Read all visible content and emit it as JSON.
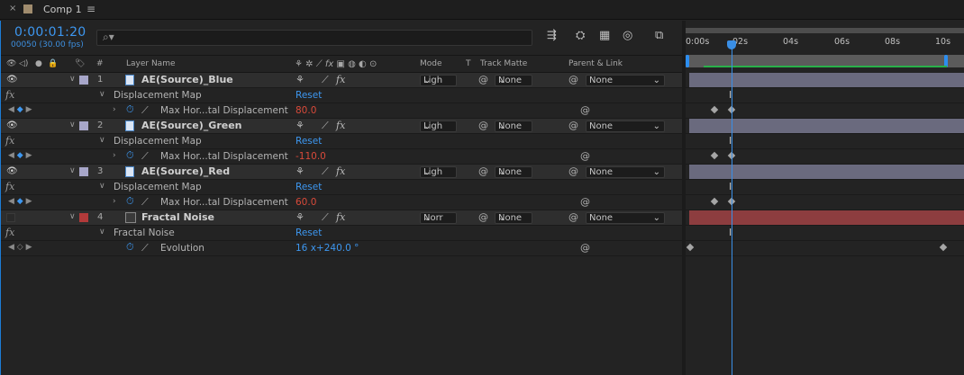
{
  "tab": {
    "close": "×",
    "title": "Comp 1",
    "menu": "≡",
    "swatch": "#a08c6e"
  },
  "header": {
    "timecode": "0:00:01:20",
    "frame_info": "00050 (30.00 fps)",
    "search_icon": "⌕▾"
  },
  "columns": {
    "layer_name": "Layer Name",
    "num": "#",
    "mode": "Mode",
    "t": "T",
    "track_matte": "Track Matte",
    "parent_link": "Parent & Link"
  },
  "layers": [
    {
      "num": "1",
      "name": "AE(Source)_Blue",
      "color": "#a7a6c9",
      "mode": "Ligh",
      "matte": "None",
      "parent": "None",
      "effect": "Displacement Map",
      "reset": "Reset",
      "prop": "Max Hor...tal Displacement",
      "value": "80.0"
    },
    {
      "num": "2",
      "name": "AE(Source)_Green",
      "color": "#a7a6c9",
      "mode": "Ligh",
      "matte": "None",
      "parent": "None",
      "effect": "Displacement Map",
      "reset": "Reset",
      "prop": "Max Hor...tal Displacement",
      "value": "-110.0"
    },
    {
      "num": "3",
      "name": "AE(Source)_Red",
      "color": "#a7a6c9",
      "mode": "Ligh",
      "matte": "None",
      "parent": "None",
      "effect": "Displacement Map",
      "reset": "Reset",
      "prop": "Max Hor...tal Displacement",
      "value": "60.0"
    },
    {
      "num": "4",
      "name": "Fractal Noise",
      "color": "#b23a3a",
      "mode": "Norr",
      "matte": "None",
      "parent": "None",
      "effect": "Fractal Noise",
      "reset": "Reset",
      "prop": "Evolution",
      "value": "16 x+240.0 °"
    }
  ],
  "timeline": {
    "ticks": [
      "0:00s",
      "02s",
      "04s",
      "06s",
      "08s",
      "10s"
    ],
    "layer_bar_color": "#6a6a7e",
    "fractal_bar_color": "#8d3d3f"
  }
}
